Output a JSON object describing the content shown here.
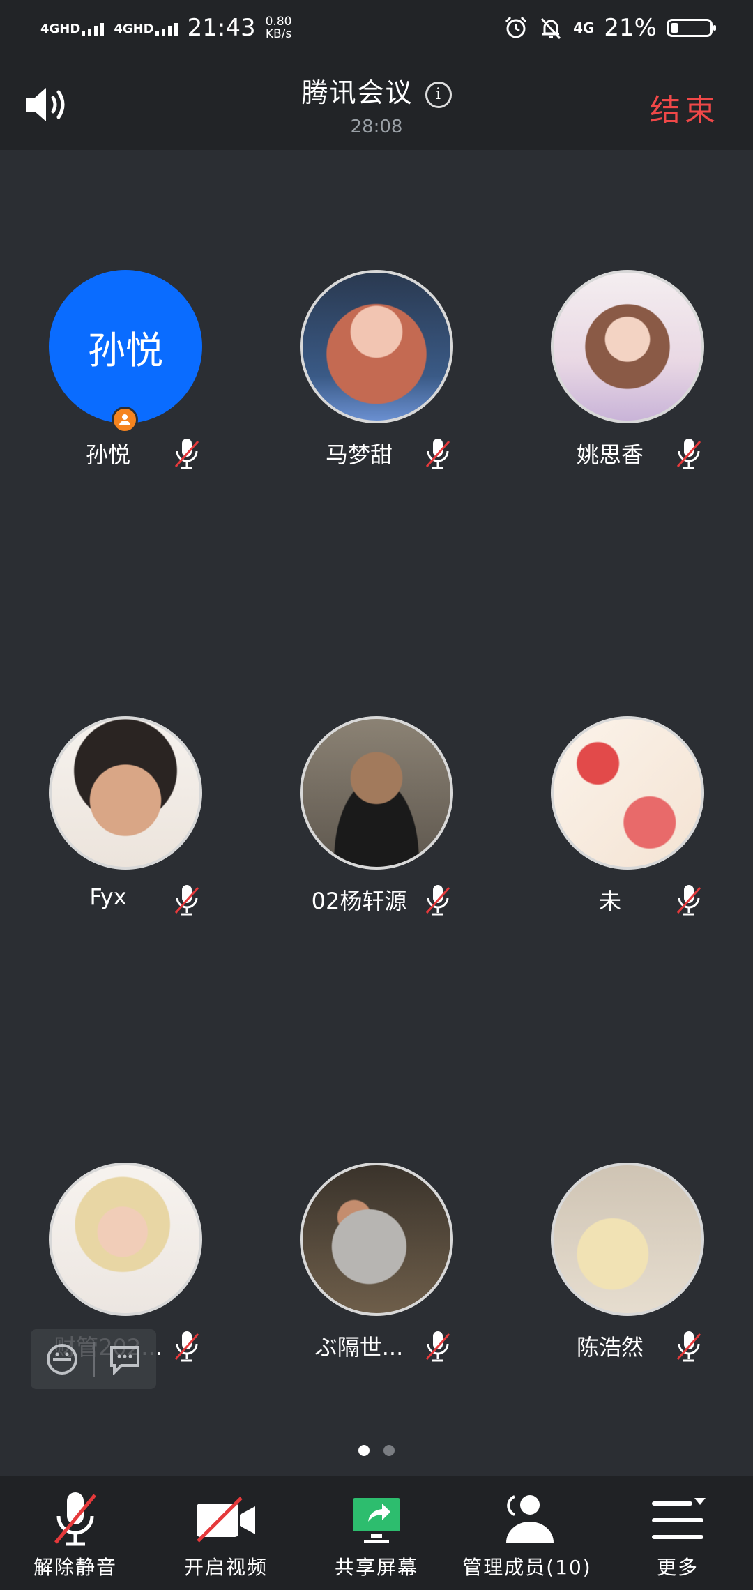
{
  "status_bar": {
    "network_1": "4GHD",
    "network_2": "4GHD",
    "time": "21:43",
    "speed_value": "0.80",
    "speed_unit": "KB/s",
    "network_3": "4G",
    "battery": "21%",
    "battery_level": 0.21
  },
  "header": {
    "title": "腾讯会议",
    "info_glyph": "i",
    "timer": "28:08",
    "end_label": "结束"
  },
  "participants": [
    {
      "name": "孙悦",
      "avatar_text": "孙悦",
      "avatar_color": "#0a6cff",
      "host": true,
      "muted": true
    },
    {
      "name": "马梦甜",
      "avatar": "photo",
      "muted": true
    },
    {
      "name": "姚思香",
      "avatar": "photo",
      "muted": true
    },
    {
      "name": "Fyx",
      "avatar": "photo",
      "muted": true
    },
    {
      "name": "02杨轩源",
      "avatar": "photo",
      "muted": true
    },
    {
      "name": "未",
      "avatar": "photo",
      "muted": true
    },
    {
      "name": "财管202...",
      "avatar": "photo",
      "muted": true
    },
    {
      "name": "ぶ隔世...",
      "avatar": "photo",
      "muted": true
    },
    {
      "name": "陈浩然",
      "avatar": "photo",
      "muted": true
    }
  ],
  "pagination": {
    "current": 1,
    "total": 2
  },
  "toolbar": {
    "unmute_label": "解除静音",
    "video_label": "开启视频",
    "share_label": "共享屏幕",
    "manage_label": "管理成员(10)",
    "more_label": "更多"
  },
  "colors": {
    "accent_blue": "#0a6cff",
    "end_red": "#f04848",
    "mute_red": "#e5393b",
    "share_green": "#2dbd6e",
    "host_badge": "#f5841f"
  }
}
